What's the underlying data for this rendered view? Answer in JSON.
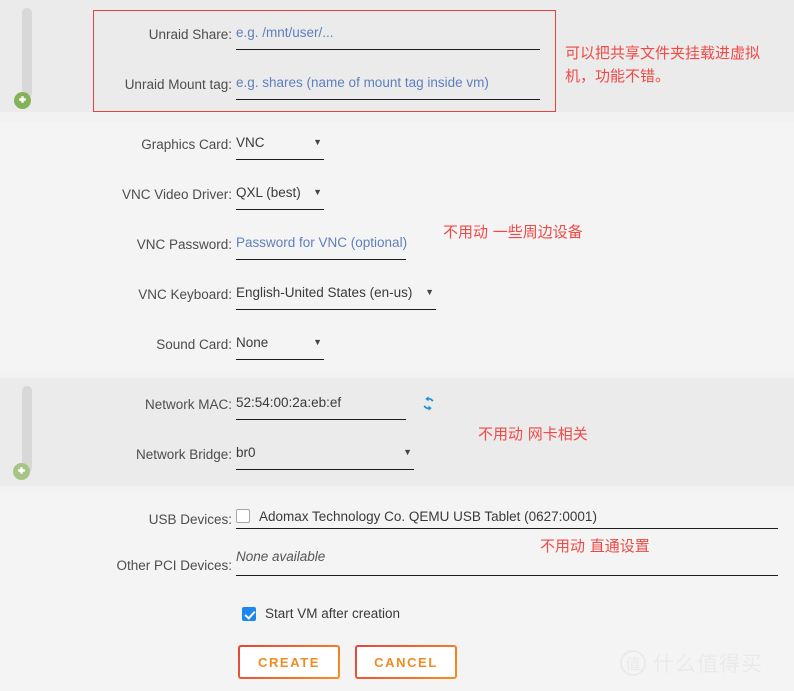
{
  "sections": {
    "shares": {
      "name": "shares-section"
    },
    "graphics": {
      "name": "graphics-section"
    },
    "network": {
      "name": "network-section"
    },
    "devices": {
      "name": "devices-section"
    }
  },
  "fields": {
    "unraid_share": {
      "label": "Unraid Share:",
      "value": "",
      "placeholder": "e.g. /mnt/user/..."
    },
    "unraid_mount_tag": {
      "label": "Unraid Mount tag:",
      "value": "",
      "placeholder": "e.g. shares (name of mount tag inside vm)"
    },
    "graphics_card": {
      "label": "Graphics Card:",
      "value": "VNC"
    },
    "vnc_video_driver": {
      "label": "VNC Video Driver:",
      "value": "QXL (best)"
    },
    "vnc_password": {
      "label": "VNC Password:",
      "value": "",
      "placeholder": "Password for VNC (optional)"
    },
    "vnc_keyboard": {
      "label": "VNC Keyboard:",
      "value": "English-United States (en-us)"
    },
    "sound_card": {
      "label": "Sound Card:",
      "value": "None"
    },
    "network_mac": {
      "label": "Network MAC:",
      "value": "52:54:00:2a:eb:ef"
    },
    "network_bridge": {
      "label": "Network Bridge:",
      "value": "br0"
    },
    "usb_devices": {
      "label": "USB Devices:",
      "option_label": "Adomax Technology Co. QEMU USB Tablet (0627:0001)",
      "checked": false
    },
    "other_pci_devices": {
      "label": "Other PCI Devices:",
      "value": "None available"
    },
    "start_vm": {
      "label": "Start VM after creation",
      "checked": true
    }
  },
  "buttons": {
    "create": "CREATE",
    "cancel": "CANCEL"
  },
  "annotations": {
    "shares": "可以把共享文件夹挂载进虚拟\n机，功能不错。",
    "peripherals": "不用动 一些周边设备",
    "network": "不用动 网卡相关",
    "passthrough": "不用动 直通设置"
  },
  "watermark": {
    "logo": "值",
    "text": "什么值得买"
  },
  "colors": {
    "annotation": "#f04a46",
    "placeholder": "#5f7fbd",
    "button_accent": "#f08c24",
    "checkbox_checked": "#1e88f0",
    "refresh_icon": "#1b8fd6",
    "add_icon": "#84b259"
  }
}
